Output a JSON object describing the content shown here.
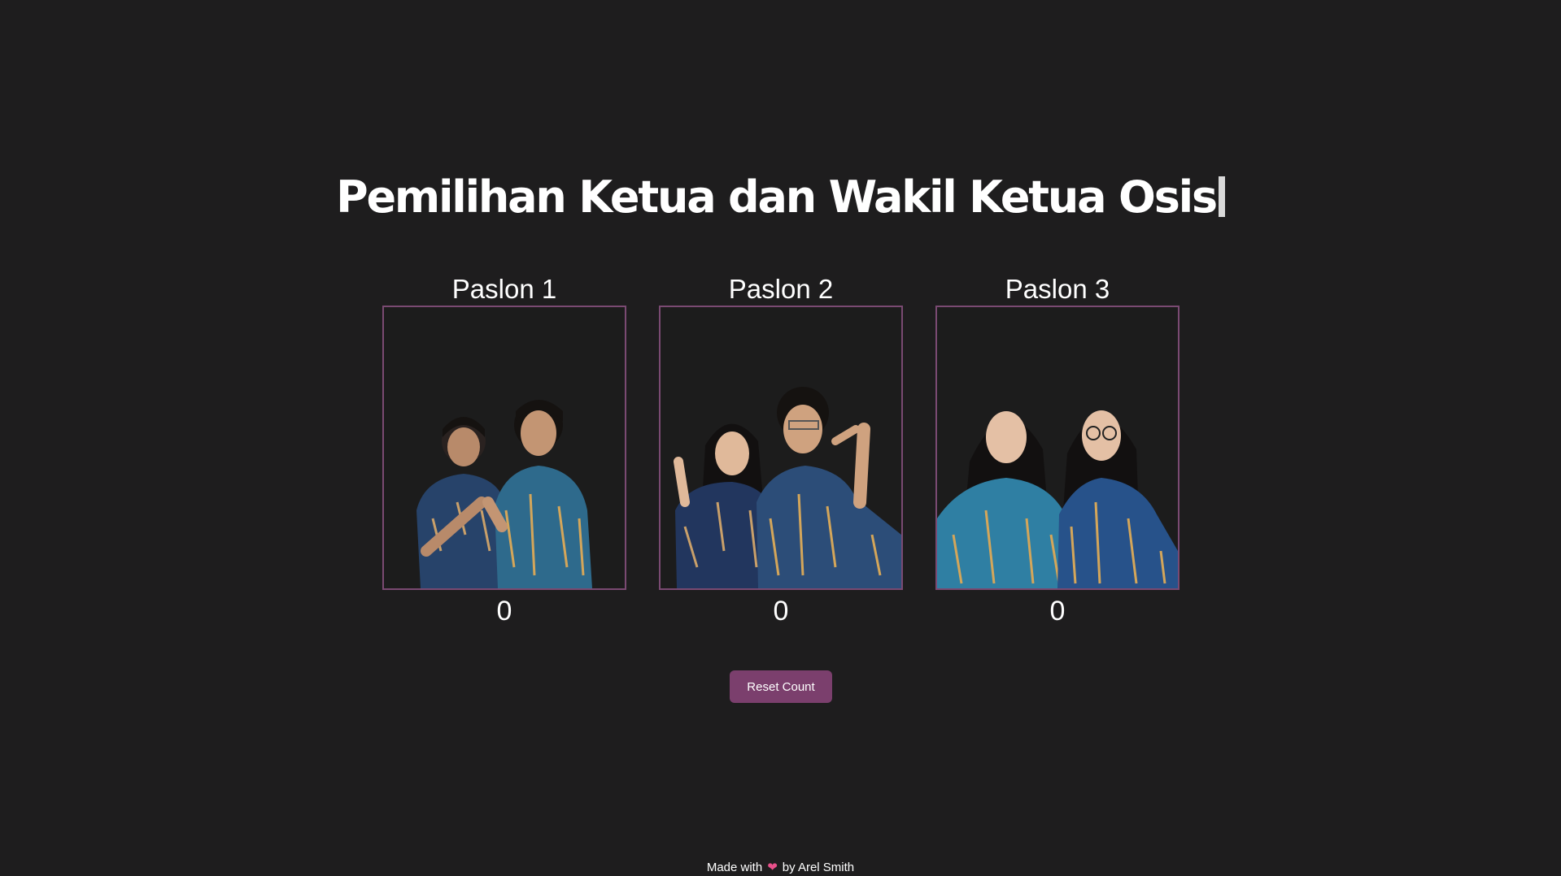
{
  "header": {
    "title": "Pemilihan Ketua dan Wakil Ketua Osis"
  },
  "candidates": [
    {
      "label": "Paslon 1",
      "count": "0"
    },
    {
      "label": "Paslon 2",
      "count": "0"
    },
    {
      "label": "Paslon 3",
      "count": "0"
    }
  ],
  "actions": {
    "reset_label": "Reset Count"
  },
  "footer": {
    "prefix": "Made with",
    "icon": "heart-icon",
    "suffix": "by Arel Smith"
  },
  "colors": {
    "background": "#1e1d1e",
    "accent": "#7b3f6d",
    "photo_border": "#7a4a72",
    "heart": "#e8508a"
  }
}
